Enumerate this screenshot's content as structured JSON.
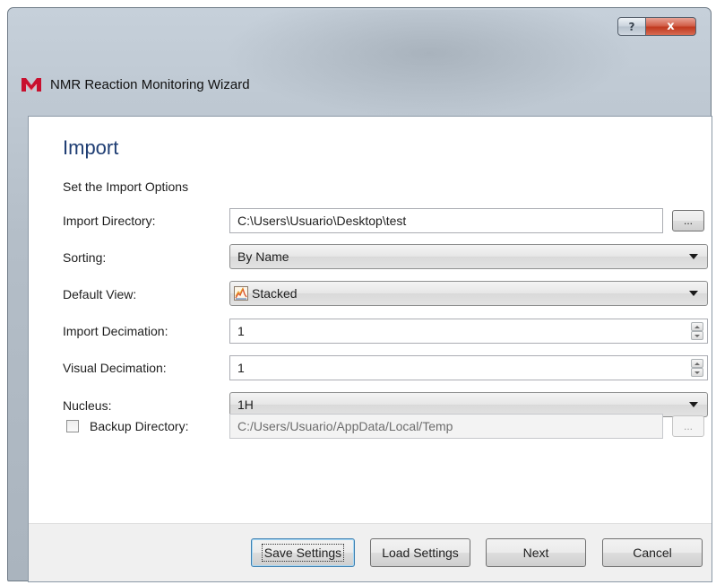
{
  "window": {
    "title": "NMR Reaction Monitoring Wizard",
    "help_label": "?",
    "close_label": "x"
  },
  "page": {
    "title": "Import",
    "subtitle": "Set the Import Options"
  },
  "fields": {
    "import_directory": {
      "label": "Import Directory:",
      "value": "C:\\Users\\Usuario\\Desktop\\test",
      "browse_label": "..."
    },
    "sorting": {
      "label": "Sorting:",
      "value": "By Name"
    },
    "default_view": {
      "label": "Default View:",
      "value": "Stacked",
      "icon": "stacked-view-icon"
    },
    "import_decimation": {
      "label": "Import Decimation:",
      "value": "1"
    },
    "visual_decimation": {
      "label": "Visual Decimation:",
      "value": "1"
    },
    "nucleus": {
      "label": "Nucleus:",
      "value": "1H"
    },
    "backup_directory": {
      "label": "Backup Directory:",
      "value": "C:/Users/Usuario/AppData/Local/Temp",
      "checked": false,
      "enabled": false,
      "browse_label": "..."
    }
  },
  "buttons": {
    "save_settings": "Save Settings",
    "load_settings": "Load Settings",
    "next": "Next",
    "cancel": "Cancel"
  },
  "colors": {
    "title_blue": "#1e3d73",
    "close_red": "#c0391f",
    "logo_red": "#c8102e"
  }
}
